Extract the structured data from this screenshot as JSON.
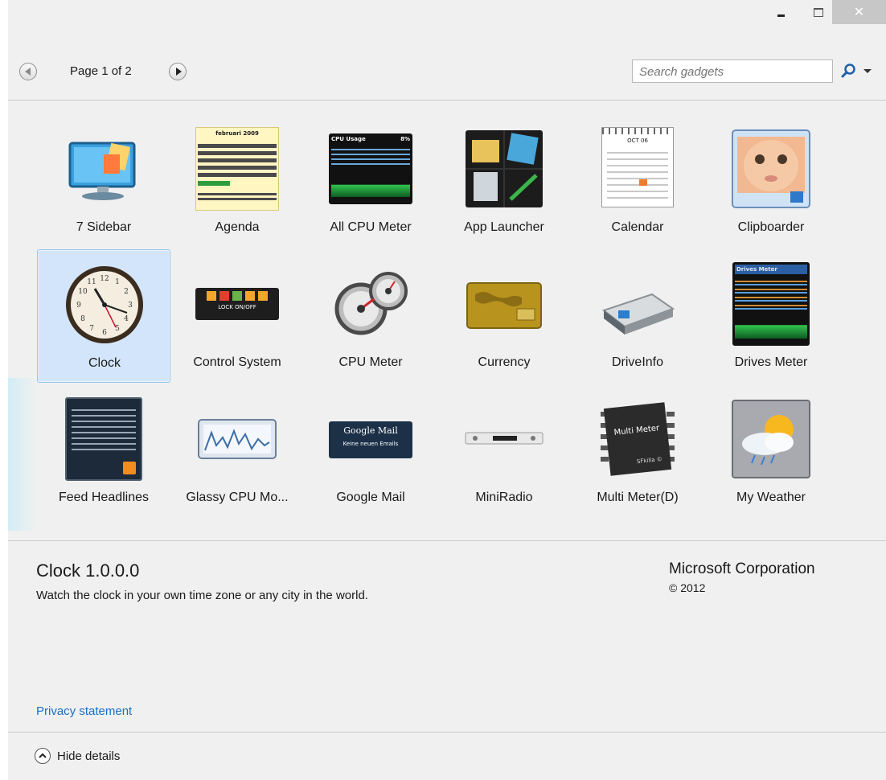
{
  "window": {
    "close_glyph": "✕"
  },
  "toolbar": {
    "page_label": "Page 1 of 2",
    "search_placeholder": "Search gadgets",
    "search_value": ""
  },
  "gadgets": [
    {
      "name": "7 Sidebar",
      "icon": "monitor-icon"
    },
    {
      "name": "Agenda",
      "icon": "agenda-calendar-icon"
    },
    {
      "name": "All CPU Meter",
      "icon": "cpu-usage-panel-icon"
    },
    {
      "name": "App Launcher",
      "icon": "app-launcher-grid-icon"
    },
    {
      "name": "Calendar",
      "icon": "spiral-calendar-icon"
    },
    {
      "name": "Clipboarder",
      "icon": "baby-photo-icon"
    },
    {
      "name": "Clock",
      "icon": "analog-clock-icon",
      "selected": true
    },
    {
      "name": "Control System",
      "icon": "control-buttons-icon"
    },
    {
      "name": "CPU Meter",
      "icon": "dual-gauge-icon"
    },
    {
      "name": "Currency",
      "icon": "gold-card-icon"
    },
    {
      "name": "DriveInfo",
      "icon": "hard-drive-icon"
    },
    {
      "name": "Drives Meter",
      "icon": "drives-meter-panel-icon"
    },
    {
      "name": "Feed Headlines",
      "icon": "feed-panel-icon"
    },
    {
      "name": "Glassy CPU Mo...",
      "icon": "cpu-graph-icon"
    },
    {
      "name": "Google Mail",
      "icon": "mail-panel-icon"
    },
    {
      "name": "MiniRadio",
      "icon": "radio-device-icon"
    },
    {
      "name": "Multi Meter(D)",
      "icon": "chip-icon"
    },
    {
      "name": "My Weather",
      "icon": "weather-icon"
    }
  ],
  "thumb_text": {
    "agenda_month": "februari 2009",
    "cpu_title": "CPU Usage",
    "cpu_pct": "8%",
    "control_label": "LOCK ON/OFF",
    "calendar_month": "OCT 06",
    "drives_title": "Drives Meter",
    "mail_title": "Google Mail",
    "mail_sub": "Keine neuen Emails",
    "chip_line1": "Multi Meter",
    "chip_line2": "SFkilla ©"
  },
  "details": {
    "title": "Clock 1.0.0.0",
    "description": "Watch the clock in your own time zone or any city in the world.",
    "publisher": "Microsoft Corporation",
    "copyright": "© 2012",
    "privacy_link": "Privacy statement"
  },
  "footer": {
    "hide_details_label": "Hide details"
  },
  "colors": {
    "background": "#f0f0f0",
    "selection": "#d3e5fa",
    "link": "#1a6fc4",
    "close_button": "#c7c7c7"
  }
}
